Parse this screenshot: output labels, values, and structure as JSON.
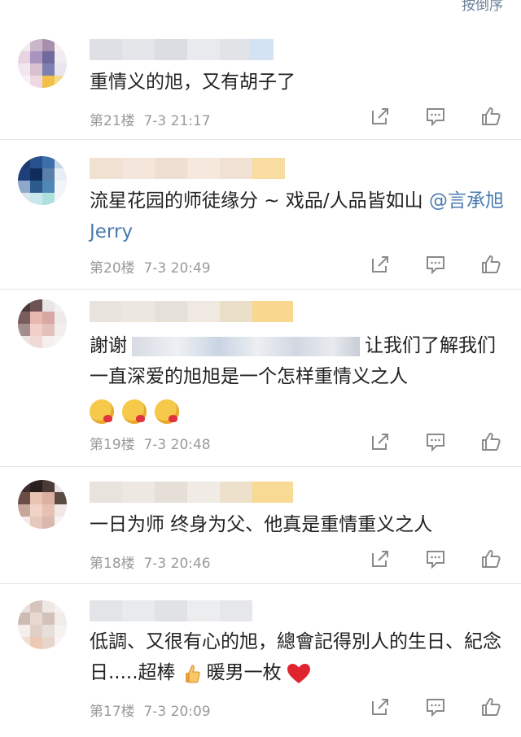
{
  "sort_label": "按倒序",
  "comments": [
    {
      "floor": "第21楼",
      "time": "7-3 21:17",
      "text": "重情义的旭，又有胡子了"
    },
    {
      "floor": "第20楼",
      "time": "7-3 20:49",
      "text": "流星花园的师徒缘分 ~ 戏品/人品皆如山 ",
      "mention": "@言承旭 Jerry"
    },
    {
      "floor": "第19楼",
      "time": "7-3 20:48",
      "text_prefix": "謝谢",
      "text_suffix": "让我们了解我们一直深爱的旭旭是一个怎样重情义之人"
    },
    {
      "floor": "第18楼",
      "time": "7-3 20:46",
      "text": "一日为师 终身为父、他真是重情重义之人"
    },
    {
      "floor": "第17楼",
      "time": "7-3 20:09",
      "text": "低調、又很有心的旭，總會記得別人的生日、紀念日.....超棒",
      "text_tail": "暖男一枚"
    }
  ],
  "colors": {
    "meta_gray": "#9a9a9a",
    "mention_blue": "#4a7bb0",
    "divider": "#e6e6e6"
  },
  "icons": [
    "share-icon",
    "comment-icon",
    "like-icon"
  ]
}
